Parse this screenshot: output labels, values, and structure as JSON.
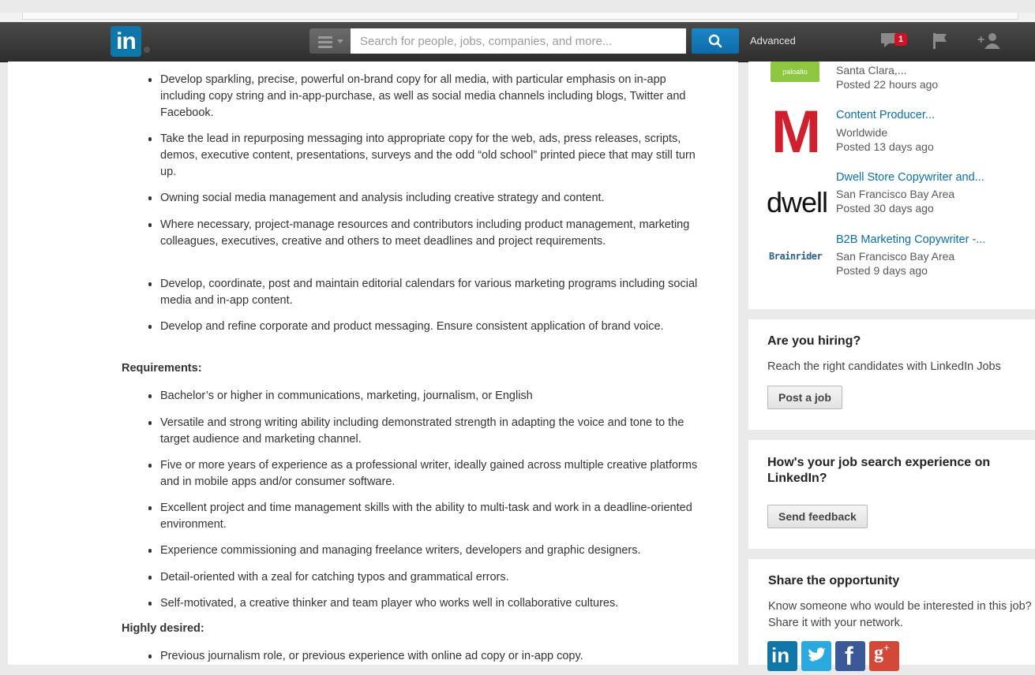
{
  "header": {
    "logo_text": "in",
    "search_placeholder": "Search for people, jobs, companies, and more...",
    "advanced_label": "Advanced",
    "notification_count": "1",
    "brand_color": "#0e76a8",
    "search_button_color": "#1679bd"
  },
  "main": {
    "bullets_top": [
      "Develop sparkling, precise, powerful on-brand copy for all media, with particular emphasis on in-app including copy string and in-app-purchase, as well as social media channels including blogs, Twitter and Facebook.",
      "Take the lead in repurposing messaging into appropriate copy for the web, ads, press releases, scripts, demos, executive content, presentations, surveys and the odd “old school” printed piece that may still turn up.",
      "Owning social media management and analysis including creative strategy and content.",
      "Where necessary, project-manage resources and contributors including product management, marketing colleagues, executives, creative and others to meet deadlines and project requirements.",
      "Develop, coordinate, post and maintain editorial calendars for various marketing programs including social media and in-app content.",
      "Develop and refine corporate and product messaging. Ensure consistent application of brand voice."
    ],
    "requirements_heading": "Requirements:",
    "requirements": [
      "Bachelor’s or higher in communications, marketing, journalism, or English",
      "Versatile and strong writing ability including demonstrated strength in adapting the voice and tone to the target audience and marketing channel.",
      "Five or more years of experience as a professional writer, ideally gained across multiple creative platforms and in mobile apps and/or consumer software.",
      "Excellent project and time management skills with the ability to multi-task and work in a deadline-oriented environment.",
      "Experience commissioning and managing freelance writers, developers and graphic designers.",
      "Detail-oriented with a zeal for catching typos and grammatical errors.",
      "Self-motivated, a creative thinker and team player who works well in collaborative cultures."
    ],
    "desired_heading": "Highly desired:",
    "desired": [
      "Previous journalism role, or previous experience with online ad copy or in-app copy."
    ]
  },
  "sidebar": {
    "jobs": [
      {
        "logo": "paloalto",
        "title": "",
        "location": "Santa Clara,...",
        "posted": "Posted 22 hours ago"
      },
      {
        "logo": "M",
        "title": "Content Producer...",
        "location": "Worldwide",
        "posted": "Posted 13 days ago"
      },
      {
        "logo": "dwell",
        "title": "Dwell Store Copywriter and...",
        "location": "San Francisco Bay Area",
        "posted": "Posted 30 days ago"
      },
      {
        "logo": "Brainrider",
        "title": "B2B Marketing Copywriter -...",
        "location": "San Francisco Bay Area",
        "posted": "Posted 9 days ago"
      }
    ],
    "hiring": {
      "title": "Are you hiring?",
      "text": "Reach the right candidates with LinkedIn Jobs",
      "button": "Post a job"
    },
    "feedback": {
      "title": "How's your job search experience on LinkedIn?",
      "button": "Send feedback"
    },
    "share": {
      "title": "Share the opportunity",
      "text": "Know someone who would be interested in this job? Share it with your network.",
      "networks": [
        "linkedin-icon",
        "twitter-icon",
        "facebook-icon",
        "google-plus-icon"
      ]
    }
  }
}
